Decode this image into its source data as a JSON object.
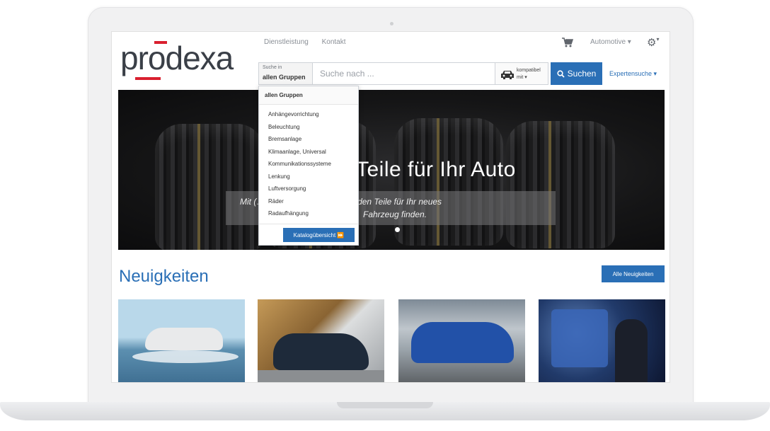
{
  "header": {
    "logo_text": "prodexa",
    "nav": [
      "Dienstleistung",
      "Kontakt"
    ],
    "automotive_select": "Automotive ▾",
    "settings_caret": "▾"
  },
  "search": {
    "scope_small": "Suche in",
    "scope_value": "allen Gruppen ▾",
    "placeholder": "Suche nach ...",
    "compat_label": "kompatibel mit ▾",
    "button_label": "Suchen",
    "expert_label": "Expertensuche ▾"
  },
  "hero": {
    "title": "Teile für Ihr Auto",
    "caption_line1": "Mit (…) und einfach die passenden Teile für Ihr neues",
    "caption_line2": "Fahrzeug finden."
  },
  "dropdown": {
    "header": "allen Gruppen",
    "items": [
      "Anhängevorrichtung",
      "Beleuchtung",
      "Bremsanlage",
      "Klimaanlage, Universal",
      "Kommunikationssysteme",
      "Lenkung",
      "Luftversorgung",
      "Räder",
      "Radaufhängung"
    ],
    "catalog_button": "Katalogübersicht ⏩"
  },
  "news": {
    "title": "Neuigkeiten",
    "all_button": "Alle Neuigkeiten"
  },
  "colors": {
    "accent": "#2a6fb6",
    "logo_red": "#d9202f"
  }
}
